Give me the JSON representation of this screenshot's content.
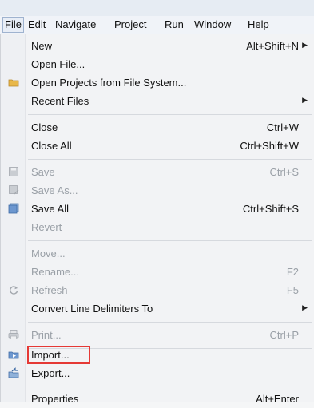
{
  "menubar": {
    "items": [
      "File",
      "Edit",
      "Navigate",
      "Project",
      "Run",
      "Window",
      "Help"
    ]
  },
  "file_menu": {
    "new": {
      "label": "New",
      "shortcut": "Alt+Shift+N"
    },
    "open_file": {
      "label": "Open File..."
    },
    "open_projects": {
      "label": "Open Projects from File System..."
    },
    "recent_files": {
      "label": "Recent Files"
    },
    "close": {
      "label": "Close",
      "shortcut": "Ctrl+W"
    },
    "close_all": {
      "label": "Close All",
      "shortcut": "Ctrl+Shift+W"
    },
    "save": {
      "label": "Save",
      "shortcut": "Ctrl+S"
    },
    "save_as": {
      "label": "Save As..."
    },
    "save_all": {
      "label": "Save All",
      "shortcut": "Ctrl+Shift+S"
    },
    "revert": {
      "label": "Revert"
    },
    "move": {
      "label": "Move..."
    },
    "rename": {
      "label": "Rename...",
      "shortcut": "F2"
    },
    "refresh": {
      "label": "Refresh",
      "shortcut": "F5"
    },
    "convert": {
      "label": "Convert Line Delimiters To"
    },
    "print": {
      "label": "Print...",
      "shortcut": "Ctrl+P"
    },
    "import": {
      "label": "Import..."
    },
    "export": {
      "label": "Export..."
    },
    "properties": {
      "label": "Properties",
      "shortcut": "Alt+Enter"
    }
  },
  "colors": {
    "highlight_border": "#e53935",
    "disabled_text": "#9aa0a7"
  }
}
